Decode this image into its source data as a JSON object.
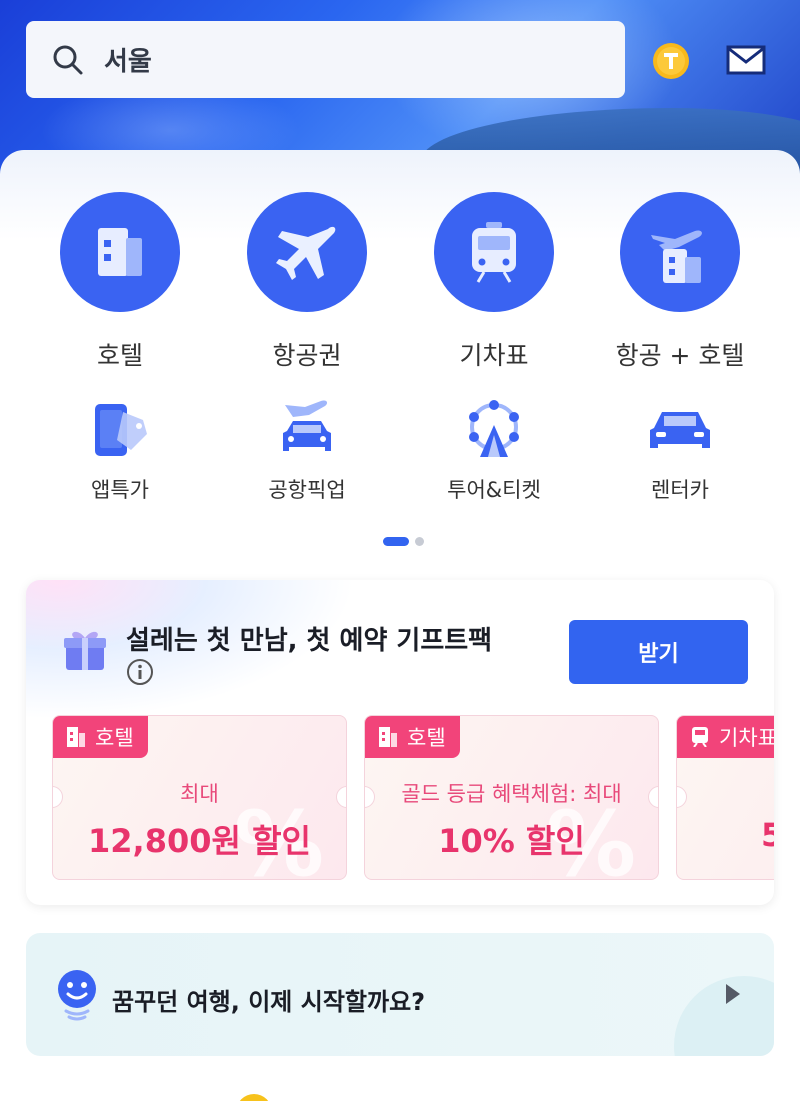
{
  "header": {
    "search_value": "서울",
    "icons": [
      "search-icon",
      "coin-t-icon",
      "mail-icon"
    ]
  },
  "main_menu": [
    {
      "label": "호텔",
      "icon": "hotel-icon"
    },
    {
      "label": "항공권",
      "icon": "airplane-icon"
    },
    {
      "label": "기차표",
      "icon": "train-icon"
    },
    {
      "label": "항공 + 호텔",
      "icon": "flight-hotel-icon"
    }
  ],
  "sub_menu": [
    {
      "label": "앱특가",
      "icon": "phone-tag-icon"
    },
    {
      "label": "공항픽업",
      "icon": "airport-pickup-icon"
    },
    {
      "label": "투어&티켓",
      "icon": "ferris-wheel-icon"
    },
    {
      "label": "렌터카",
      "icon": "rental-car-icon"
    }
  ],
  "gift": {
    "title": "설레는 첫 만남, 첫 예약 기프트팩",
    "button": "받기",
    "coupons": [
      {
        "category": "호텔",
        "subtitle": "최대",
        "discount": "12,800원 할인"
      },
      {
        "category": "호텔",
        "subtitle": "골드 등급 혜택체험: 최대",
        "discount": "10% 할인"
      },
      {
        "category": "기차표",
        "subtitle": "",
        "discount": "5"
      }
    ]
  },
  "prompt": {
    "text": "꿈꾸던 여행, 이제 시작할까요?"
  },
  "colors": {
    "primary": "#3264f0",
    "coupon_pink": "#f2447a"
  }
}
